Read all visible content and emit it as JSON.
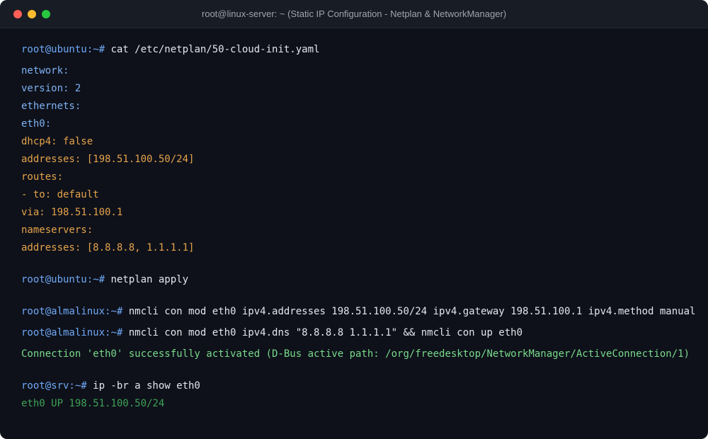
{
  "window": {
    "title": "root@linux-server: ~ (Static IP Configuration - Netplan & NetworkManager)"
  },
  "terminal": {
    "block1": {
      "prompt": "root@ubuntu:~#",
      "command": " cat /etc/netplan/50-cloud-init.yaml"
    },
    "yaml": [
      "network:",
      "version: 2",
      "ethernets:",
      "eth0:",
      "dhcp4: false",
      "addresses: [198.51.100.50/24]",
      "routes:",
      "- to: default",
      "via: 198.51.100.1",
      "nameservers:",
      "addresses: [8.8.8.8, 1.1.1.1]"
    ],
    "block2": {
      "prompt": "root@ubuntu:~#",
      "command": " netplan apply"
    },
    "block3": {
      "prompt": "root@almalinux:~#",
      "command": " nmcli con mod eth0 ipv4.addresses 198.51.100.50/24 ipv4.gateway 198.51.100.1 ipv4.method manual"
    },
    "block4": {
      "prompt": "root@almalinux:~#",
      "command": " nmcli con mod eth0 ipv4.dns \"8.8.8.8 1.1.1.1\" && nmcli con up eth0"
    },
    "success_message": "Connection 'eth0' successfully activated (D-Bus active path: /org/freedesktop/NetworkManager/ActiveConnection/1)",
    "block5": {
      "prompt": "root@srv:~#",
      "command": " ip -br a show eth0"
    },
    "ip_output": "eth0 UP 198.51.100.50/24"
  },
  "colors": {
    "background": "#0e111a",
    "titlebar": "#181c25",
    "prompt": "#6fa8f5",
    "command": "#e3e6ed",
    "yaml_key": "#7fb1f3",
    "yaml_value": "#e5a24a",
    "success": "#79d98a",
    "ip_output": "#3ea155"
  }
}
